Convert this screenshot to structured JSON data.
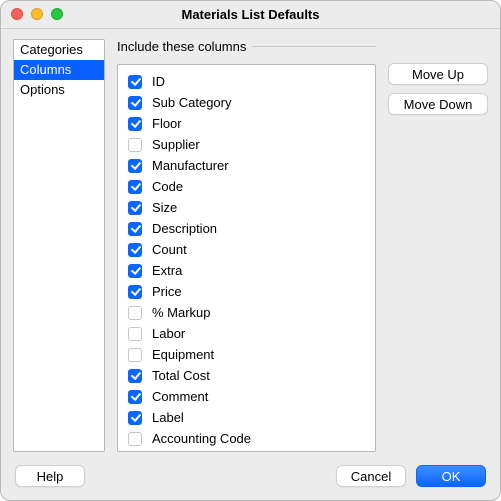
{
  "window": {
    "title": "Materials List Defaults"
  },
  "sidebar": {
    "items": [
      {
        "label": "Categories",
        "selected": false
      },
      {
        "label": "Columns",
        "selected": true
      },
      {
        "label": "Options",
        "selected": false
      }
    ]
  },
  "columns_panel": {
    "legend": "Include these columns",
    "items": [
      {
        "label": "ID",
        "checked": true
      },
      {
        "label": "Sub Category",
        "checked": true
      },
      {
        "label": "Floor",
        "checked": true
      },
      {
        "label": "Supplier",
        "checked": false
      },
      {
        "label": "Manufacturer",
        "checked": true
      },
      {
        "label": "Code",
        "checked": true
      },
      {
        "label": "Size",
        "checked": true
      },
      {
        "label": "Description",
        "checked": true
      },
      {
        "label": "Count",
        "checked": true
      },
      {
        "label": "Extra",
        "checked": true
      },
      {
        "label": "Price",
        "checked": true
      },
      {
        "label": "% Markup",
        "checked": false
      },
      {
        "label": "Labor",
        "checked": false
      },
      {
        "label": "Equipment",
        "checked": false
      },
      {
        "label": "Total Cost",
        "checked": true
      },
      {
        "label": "Comment",
        "checked": true
      },
      {
        "label": "Label",
        "checked": true
      },
      {
        "label": "Accounting Code",
        "checked": false
      }
    ]
  },
  "reorder": {
    "move_up": "Move Up",
    "move_down": "Move Down"
  },
  "footer": {
    "help": "Help",
    "cancel": "Cancel",
    "ok": "OK"
  }
}
